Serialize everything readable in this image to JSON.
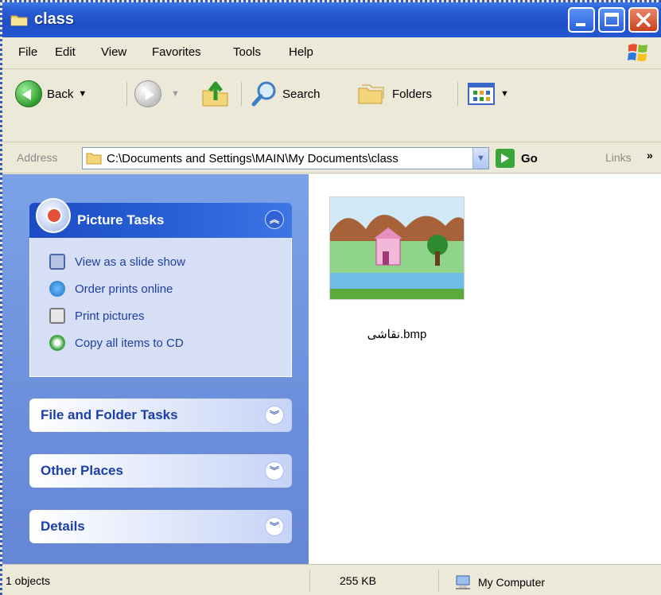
{
  "window": {
    "title": "class"
  },
  "menu": [
    "File",
    "Edit",
    "View",
    "Favorites",
    "Tools",
    "Help"
  ],
  "toolbar": {
    "back_label": "Back",
    "search_label": "Search",
    "folders_label": "Folders"
  },
  "address": {
    "label": "Address",
    "path": "C:\\Documents and Settings\\MAIN\\My Documents\\class",
    "go_label": "Go",
    "links_label": "Links",
    "links_more": "»"
  },
  "taskpane": {
    "picture_tasks": {
      "title": "Picture Tasks",
      "items": [
        "View as a slide show",
        "Order prints online",
        "Print pictures",
        "Copy all items to CD"
      ]
    },
    "file_folder_tasks": {
      "title": "File and Folder Tasks"
    },
    "other_places": {
      "title": "Other Places"
    },
    "details": {
      "title": "Details"
    }
  },
  "files": [
    {
      "name": "نقاشی.bmp",
      "icon": "painting-thumbnail"
    }
  ],
  "status": {
    "objects": "1 objects",
    "size": "255 KB",
    "location": "My Computer"
  },
  "colors": {
    "titlebar": "#2458d0",
    "taskpane": "#6c8fdb",
    "panel_title": "#1c3faa",
    "task_link": "#1f3f9e"
  }
}
